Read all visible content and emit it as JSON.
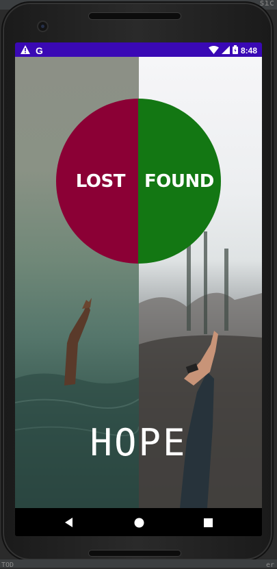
{
  "ide": {
    "top_right_text": "sic",
    "bottom_left_text": "TOD",
    "bottom_right_text": "er"
  },
  "status_bar": {
    "background": "#3a09b5",
    "left_icons": [
      "warning-icon",
      "google-g-icon"
    ],
    "google_letter": "G",
    "right_icons": [
      "wifi-icon",
      "signal-icon",
      "battery-icon"
    ],
    "time": "8:48"
  },
  "app": {
    "left_label": "LOST",
    "right_label": "FOUND",
    "lost_color": "#8b0035",
    "found_color": "#137713",
    "bottom_text": "HOPE"
  },
  "nav_bar": {
    "buttons": [
      "back-icon",
      "home-icon",
      "recents-icon"
    ]
  }
}
